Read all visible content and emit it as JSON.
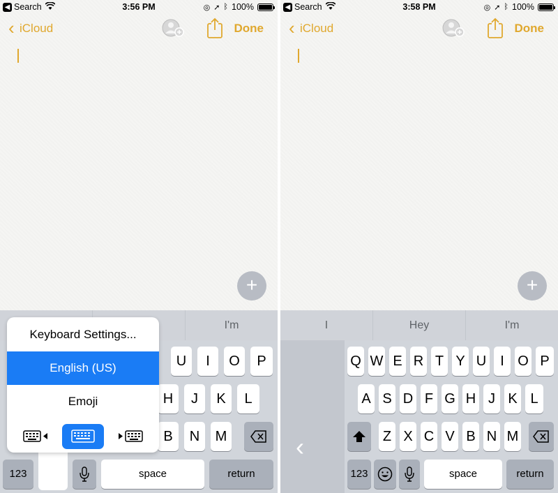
{
  "left": {
    "status": {
      "back_app": "Search",
      "time": "3:56 PM",
      "battery": "100%"
    },
    "nav": {
      "back_label": "iCloud",
      "done_label": "Done"
    },
    "predictive": [
      "",
      "",
      "I'm"
    ],
    "popup": {
      "settings": "Keyboard Settings...",
      "english": "English (US)",
      "emoji": "Emoji"
    },
    "keys": {
      "row1": [
        "U",
        "I",
        "O",
        "P"
      ],
      "row2": [
        "H",
        "J",
        "K",
        "L"
      ],
      "row3": [
        "B",
        "N",
        "M"
      ],
      "num": "123",
      "space": "space",
      "return": "return"
    }
  },
  "right": {
    "status": {
      "back_app": "Search",
      "time": "3:58 PM",
      "battery": "100%"
    },
    "nav": {
      "back_label": "iCloud",
      "done_label": "Done"
    },
    "predictive": [
      "I",
      "Hey",
      "I'm"
    ],
    "keys": {
      "row1": [
        "Q",
        "W",
        "E",
        "R",
        "T",
        "Y",
        "U",
        "I",
        "O",
        "P"
      ],
      "row2": [
        "A",
        "S",
        "D",
        "F",
        "G",
        "H",
        "J",
        "K",
        "L"
      ],
      "row3": [
        "Z",
        "X",
        "C",
        "V",
        "B",
        "N",
        "M"
      ],
      "num": "123",
      "space": "space",
      "return": "return"
    }
  },
  "colors": {
    "accent": "#e0a82e",
    "selected": "#1a7cf5",
    "keyboard_bg": "#d1d5db"
  }
}
